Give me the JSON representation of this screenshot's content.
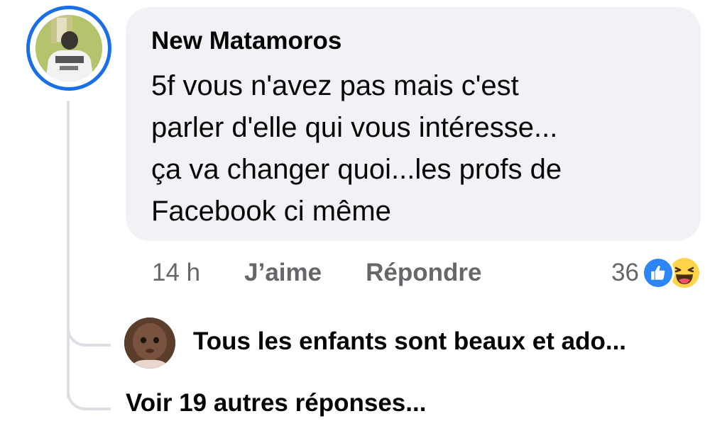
{
  "comment": {
    "author": "New Matamoros",
    "lines": [
      "5f vous n'avez pas mais c'est",
      "parler d'elle qui vous intéresse...",
      "ça va changer quoi...les profs de",
      "Facebook ci même"
    ],
    "time": "14 h",
    "like_label": "J’aime",
    "reply_label": "Répondre",
    "reaction_count": "36",
    "reactions": [
      "like-icon",
      "haha-icon"
    ]
  },
  "reply_preview": {
    "text": "Tous les enfants sont beaux et ado..."
  },
  "more_replies_label": "Voir 19 autres réponses...",
  "colors": {
    "story_ring": "#1a6ee6",
    "bubble": "#f0f2f5",
    "text": "#050505",
    "meta": "#65676b",
    "like": "#2d86f7",
    "haha": "#ffd44a"
  }
}
